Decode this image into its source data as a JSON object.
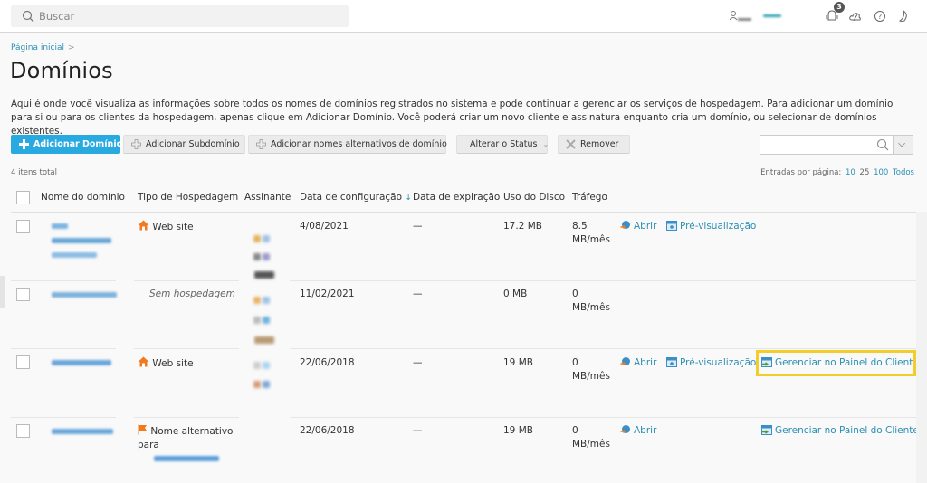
{
  "topbar": {
    "search_placeholder": "Buscar",
    "notifications_count": "3",
    "icons": [
      "user-icon",
      "notification-icon",
      "cloud-icon",
      "help-icon",
      "dark-mode-icon"
    ]
  },
  "breadcrumb": {
    "home": "Página inicial",
    "separator": ">"
  },
  "page": {
    "title": "Domínios",
    "description": "Aqui é onde você visualiza as informações sobre todos os nomes de domínios registrados no sistema e pode continuar a gerenciar os serviços de hospedagem. Para adicionar um domínio para si ou para os clientes da hospedagem, apenas clique em Adicionar Domínio. Você poderá criar um novo cliente e assinatura enquanto cria um domínio, ou selecionar de domínios existentes."
  },
  "toolbar": {
    "add_domain": "Adicionar Domínio",
    "add_subdomain": "Adicionar Subdomínio",
    "add_alias": "Adicionar nomes alternativos de domínio",
    "change_status": "Alterar o Status",
    "remove": "Remover",
    "filter_value": ""
  },
  "list": {
    "total": "4 itens total",
    "per_page_label": "Entradas por página:",
    "per_page_options": [
      "10",
      "25",
      "100",
      "Todos"
    ]
  },
  "table": {
    "columns": [
      "Nome do domínio",
      "Tipo de Hospedagem",
      "Assinante",
      "Data de configuração",
      "Data de expiração",
      "Uso do Disco",
      "Tráfego"
    ],
    "sort_indicator": "↓",
    "rows": [
      {
        "hosting": "Web site",
        "hosting_type": "website",
        "config_date": "4/08/2021",
        "expiration": "—",
        "disk": "17.2 MB",
        "traffic_value": "8.5",
        "traffic_unit": "MB/mês",
        "actions": [
          "Abrir",
          "Pré-visualização"
        ]
      },
      {
        "hosting": "Sem hospedagem",
        "hosting_type": "none",
        "config_date": "11/02/2021",
        "expiration": "—",
        "disk": "0 MB",
        "traffic_value": "0",
        "traffic_unit": "MB/mês",
        "actions": []
      },
      {
        "hosting": "Web site",
        "hosting_type": "website",
        "config_date": "22/06/2018",
        "expiration": "—",
        "disk": "19 MB",
        "traffic_value": "0",
        "traffic_unit": "MB/mês",
        "actions": [
          "Abrir",
          "Pré-visualização",
          "Gerenciar no Painel do Cliente"
        ]
      },
      {
        "hosting": "Nome alternativo para",
        "hosting_type": "alias",
        "config_date": "22/06/2018",
        "expiration": "—",
        "disk": "19 MB",
        "traffic_value": "0",
        "traffic_unit": "MB/mês",
        "actions": [
          "Abrir",
          "Gerenciar no Painel do Cliente"
        ]
      }
    ]
  },
  "colors": {
    "accent": "#28a9df",
    "link": "#2b8fb3",
    "highlight": "#f2cd2c",
    "house": "#f07a1e"
  }
}
